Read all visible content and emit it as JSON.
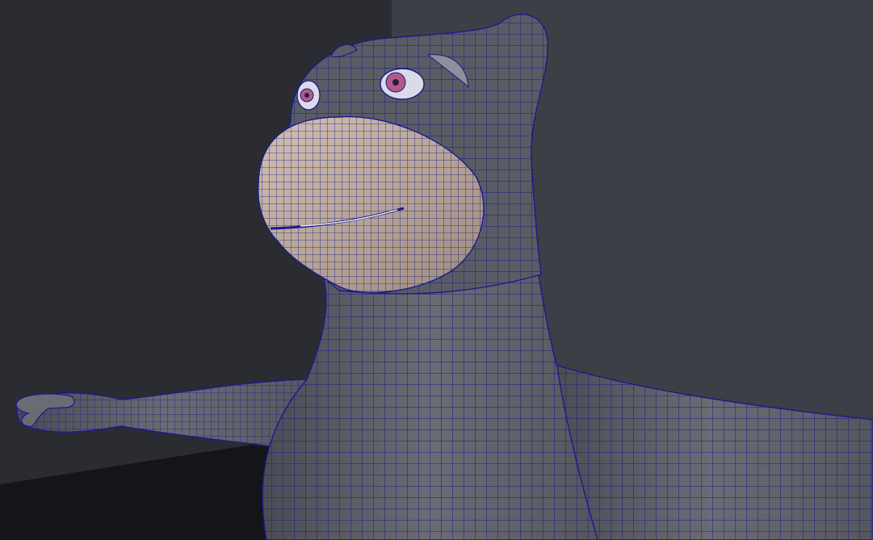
{
  "viewport": {
    "scene": "3d-wireframe-viewport",
    "colors": {
      "background_wall_left": "#2a2c31",
      "background_wall_right": "#3c3f46",
      "floor": "#15161a",
      "mesh_body": "#5c5e66",
      "mesh_muzzle": "#b9a596",
      "wire": "#1a1a8c",
      "eye_iris": "#b35a8a"
    }
  }
}
